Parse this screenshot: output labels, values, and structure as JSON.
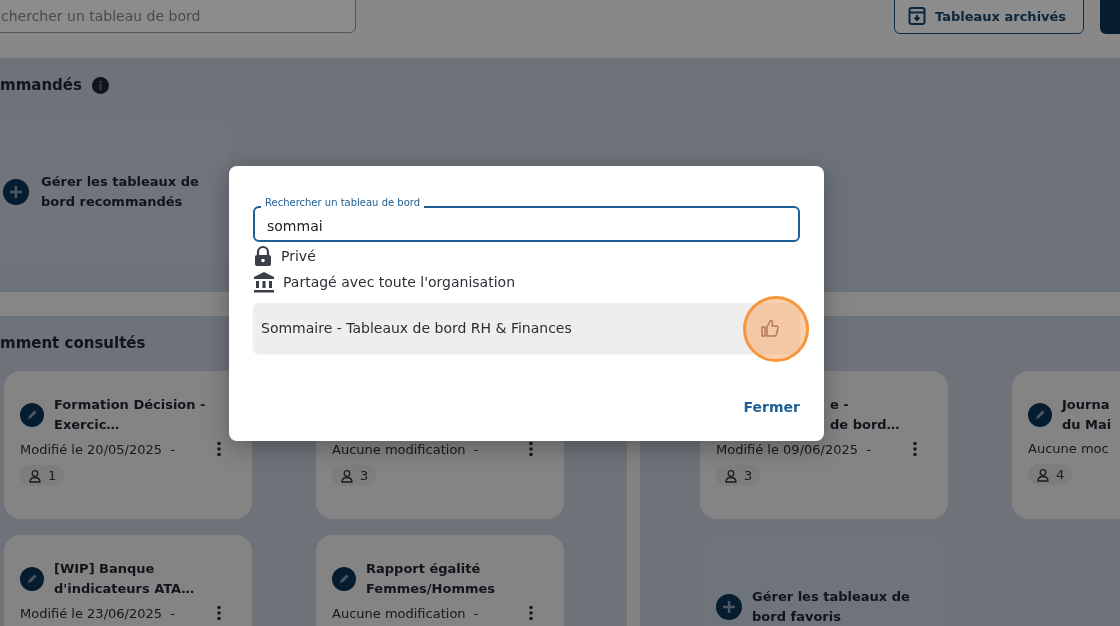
{
  "topbar": {
    "search": {
      "placeholder": "chercher un tableau de bord"
    },
    "archive_button": "Tableaux archivés"
  },
  "recommended": {
    "title": "mmandés",
    "manage_card": "Gérer les tableaux de bord recommandés"
  },
  "recent": {
    "title": "mment consultés",
    "left_cards": [
      {
        "kind": "full",
        "title": "Formation Décision - Exercic…",
        "meta": "Modifié le 20/05/2025  -",
        "users": "1"
      },
      {
        "kind": "covered",
        "meta": "Aucune modification  -",
        "users": "3"
      },
      {
        "kind": "full",
        "title": "[WIP] Banque d'indicateurs ATA…",
        "meta": "Modifié le 23/06/2025  -"
      },
      {
        "kind": "full",
        "title": "Rapport égalité Femmes/Hommes",
        "meta": "Aucune modification  -"
      }
    ],
    "right_cards": [
      {
        "kind": "covered",
        "title_lines": [
          "e -",
          "de bord…"
        ],
        "meta": "Modifié le 09/06/2025  -",
        "users": "3"
      },
      {
        "kind": "full",
        "title_lines": [
          "Journa",
          "du Mai"
        ],
        "meta": "Aucune moc",
        "users": "4"
      },
      {
        "kind": "manage",
        "title_lines": [
          "Gérer les tableaux de",
          "bord favoris"
        ]
      }
    ]
  },
  "dialog": {
    "search": {
      "label": "Rechercher un tableau de bord",
      "value": "sommai"
    },
    "legend": [
      {
        "kind": "private",
        "label": "Privé"
      },
      {
        "kind": "shared",
        "label": "Partagé avec toute l'organisation"
      }
    ],
    "results": [
      {
        "label": "Sommaire - Tableaux de bord RH & Finances",
        "highlighted": true
      }
    ],
    "close_button": "Fermer"
  }
}
